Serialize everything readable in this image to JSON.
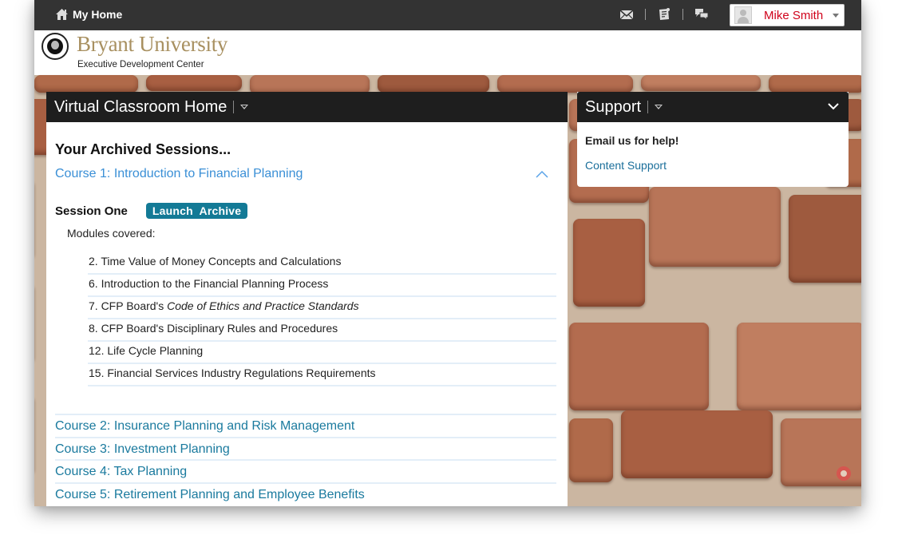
{
  "topbar": {
    "home_label": "My Home",
    "icons": [
      "messages-icon",
      "notes-icon",
      "chat-icon"
    ],
    "user": {
      "name": "Mike Smith",
      "avatar": "default-avatar"
    }
  },
  "brand": {
    "name": "Bryant University",
    "subtitle": "Executive Development Center"
  },
  "main_panel": {
    "title": "Virtual Classroom Home",
    "section_title": "Your Archived Sessions...",
    "expanded_course": {
      "label": "Course 1: Introduction to Financial Planning",
      "session": {
        "label": "Session One",
        "button": "Launch  Archive",
        "modules_label": "Modules covered:",
        "modules": [
          {
            "prefix": "2. Time Value of Money Concepts and Calculations",
            "italic": ""
          },
          {
            "prefix": "6. Introduction to the Financial Planning Process",
            "italic": ""
          },
          {
            "prefix": "7. CFP Board's ",
            "italic": "Code of Ethics and Practice Standards"
          },
          {
            "prefix": "8. CFP Board's Disciplinary Rules and Procedures",
            "italic": ""
          },
          {
            "prefix": "12. Life Cycle Planning",
            "italic": ""
          },
          {
            "prefix": "15. Financial Services Industry Regulations Requirements",
            "italic": ""
          }
        ]
      }
    },
    "courses": [
      "Course 2: Insurance Planning and Risk Management",
      "Course 3: Investment Planning",
      "Course 4: Tax Planning",
      "Course 5: Retirement Planning and Employee Benefits"
    ]
  },
  "support_panel": {
    "title": "Support",
    "text": "Email us for help!",
    "link": "Content Support"
  },
  "colors": {
    "topbar": "#333333",
    "panel_header": "#1e1e1e",
    "accent_button": "#137a96",
    "course_link": "#1a7a9e",
    "expanded_link": "#3a8fd6",
    "user_name": "#d0021b",
    "brand_gold": "#a89060"
  }
}
